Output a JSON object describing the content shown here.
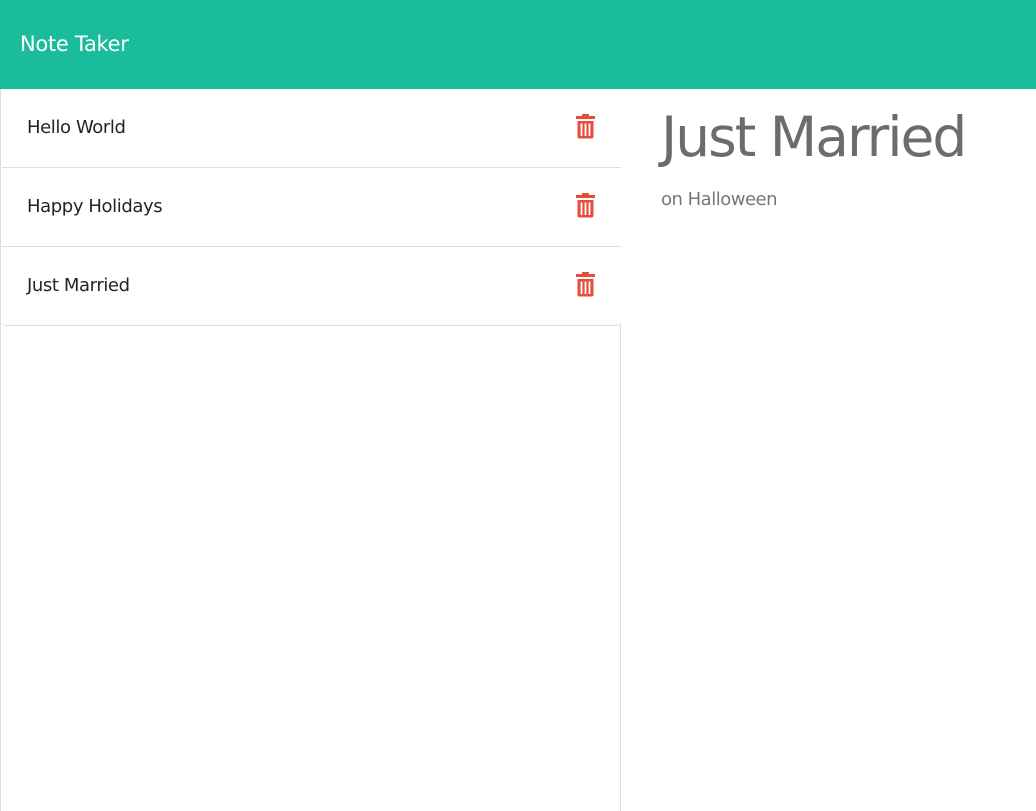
{
  "navbar": {
    "brand": "Note Taker",
    "background_color": "#1abc9c"
  },
  "notes": [
    {
      "title": "Hello World",
      "delete_icon": "trash-icon"
    },
    {
      "title": "Happy Holidays",
      "delete_icon": "trash-icon"
    },
    {
      "title": "Just Married",
      "delete_icon": "trash-icon"
    }
  ],
  "active_note": {
    "title": "Just Married",
    "text": "on Halloween"
  },
  "colors": {
    "delete_icon": "#e74c3c",
    "note_title_text": "#212529",
    "detail_text": "#6c6c6c"
  }
}
